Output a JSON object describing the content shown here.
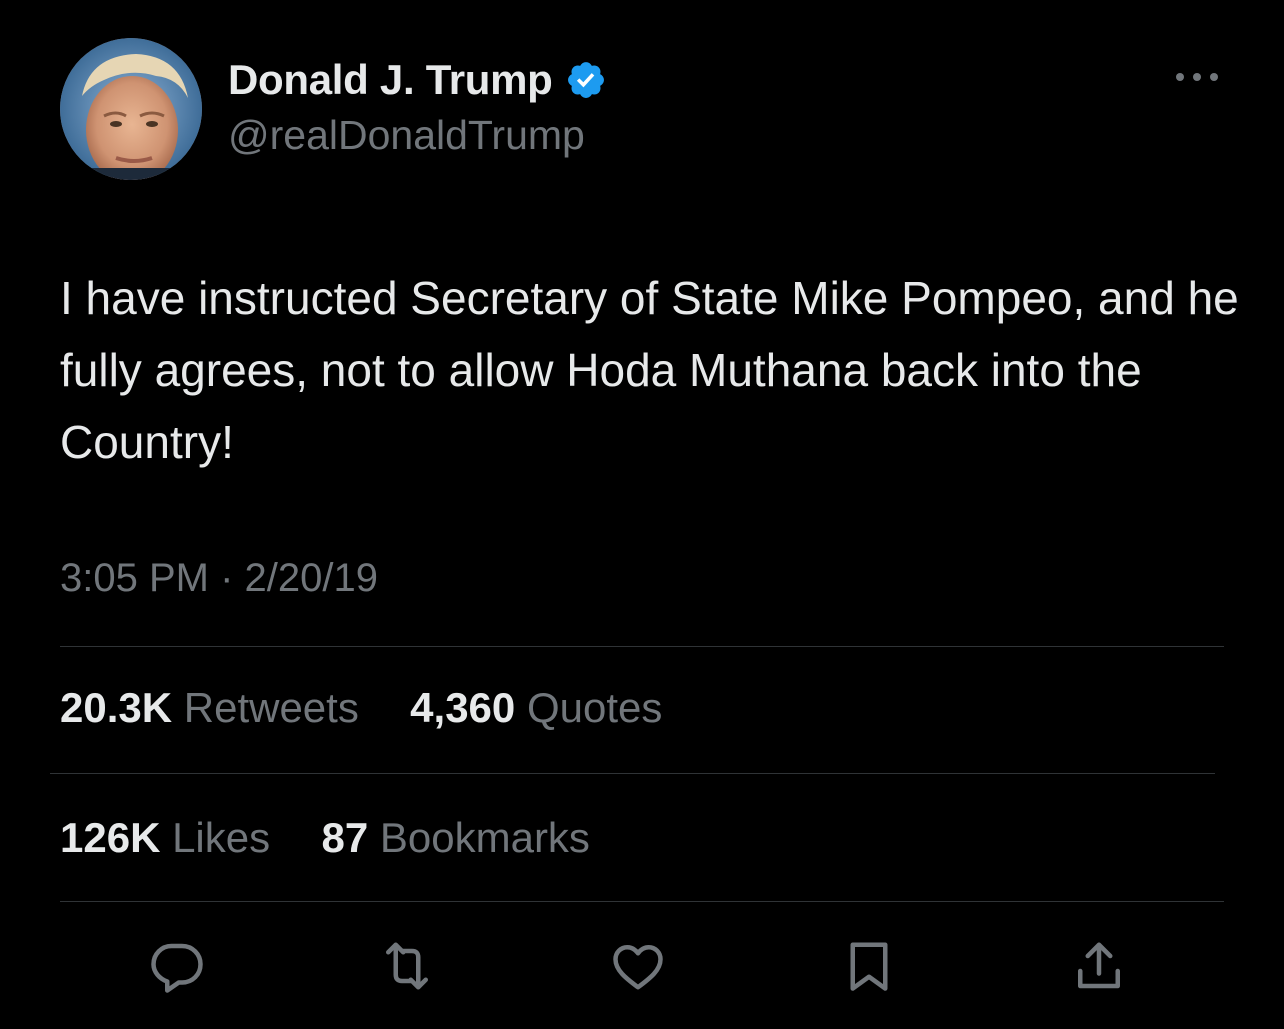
{
  "author": {
    "display_name": "Donald J. Trump",
    "handle": "@realDonaldTrump",
    "verified": true,
    "verified_color": "#1d9bf0"
  },
  "tweet": {
    "text": "I have instructed Secretary of State Mike Pompeo, and he fully agrees, not to allow Hoda Muthana back into the Country!",
    "time": "3:05 PM",
    "separator": "·",
    "date": "2/20/19"
  },
  "stats": {
    "retweets_count": "20.3K",
    "retweets_label": "Retweets",
    "quotes_count": "4,360",
    "quotes_label": "Quotes",
    "likes_count": "126K",
    "likes_label": "Likes",
    "bookmarks_count": "87",
    "bookmarks_label": "Bookmarks"
  },
  "icons": {
    "more": "more-icon",
    "reply": "reply-icon",
    "retweet": "retweet-icon",
    "like": "heart-icon",
    "bookmark": "bookmark-icon",
    "share": "share-icon"
  },
  "colors": {
    "background": "#000000",
    "primary_text": "#e7e9ea",
    "secondary_text": "#71767b",
    "divider": "#2f3336"
  }
}
